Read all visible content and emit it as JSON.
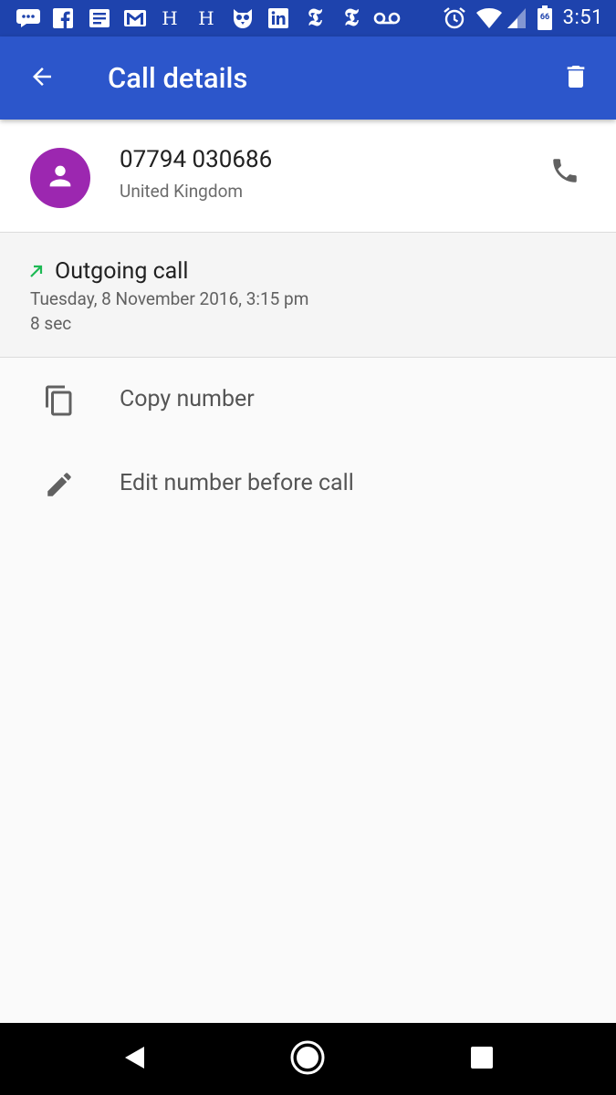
{
  "status_bar": {
    "time": "3:51",
    "battery_level": "66",
    "notification_icons": [
      "messages-icon",
      "facebook-icon",
      "news-icon",
      "gmail-icon",
      "h-icon",
      "h-icon",
      "owl-icon",
      "linkedin-icon",
      "nytimes-icon",
      "nytimes-icon",
      "voicemail-icon"
    ],
    "system_icons": [
      "alarm-icon",
      "wifi-icon",
      "signal-icon",
      "battery-icon"
    ]
  },
  "app_bar": {
    "title": "Call details",
    "back_icon": "arrow-back-icon",
    "delete_icon": "delete-icon",
    "color": "#2c56cb"
  },
  "contact": {
    "number": "07794 030686",
    "location": "United Kingdom",
    "avatar_color": "#9c27b0",
    "call_icon": "phone-icon"
  },
  "call": {
    "type": "Outgoing call",
    "datetime": "Tuesday, 8 November 2016, 3:15 pm",
    "duration": "8 sec",
    "direction_color": "#1db954"
  },
  "actions": [
    {
      "label": "Copy number",
      "icon": "copy-icon"
    },
    {
      "label": "Edit number before call",
      "icon": "edit-icon"
    }
  ],
  "nav_bar": [
    "back-nav-icon",
    "home-nav-icon",
    "recents-nav-icon"
  ]
}
